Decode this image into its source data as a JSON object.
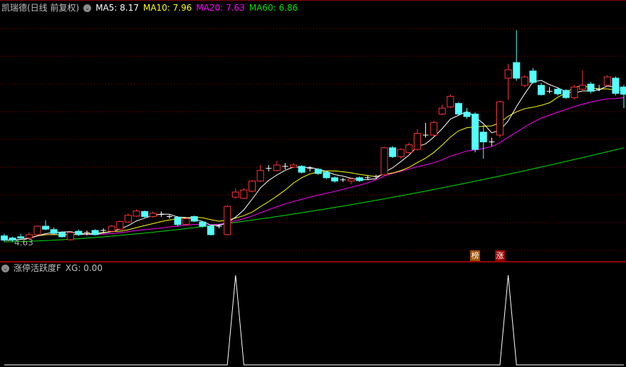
{
  "header": {
    "title": "凯瑞德(日线 前复权)",
    "ma": [
      {
        "label": "MA5: 8.17",
        "color": "#ffffff"
      },
      {
        "label": "MA10: 7.96",
        "color": "#ffff00"
      },
      {
        "label": "MA20: 7.63",
        "color": "#ff00ff"
      },
      {
        "label": "MA60: 6.86",
        "color": "#00e000"
      }
    ]
  },
  "indicator": {
    "title": "涨停活跃度F",
    "value_label": "XG: 0.00"
  },
  "markers": [
    {
      "index": 57,
      "text": "榜",
      "color": "#a05000"
    },
    {
      "index": 60,
      "text": "涨",
      "color": "#a00000"
    }
  ],
  "low_label": "4.63",
  "colors": {
    "up": "#ff3333",
    "down": "#54ffff",
    "grid": "#8b0000",
    "divider": "#c00000"
  },
  "chart_data": {
    "type": "candlestick",
    "ylim": [
      4.5,
      9.8
    ],
    "ohlc": [
      [
        4.77,
        4.67,
        4.82,
        4.63
      ],
      [
        4.72,
        4.67,
        4.75,
        4.63
      ],
      [
        4.75,
        4.72,
        4.82,
        4.68
      ],
      [
        4.72,
        4.8,
        4.85,
        4.7
      ],
      [
        4.8,
        5.0,
        5.02,
        4.78
      ],
      [
        5.0,
        4.93,
        5.14,
        4.9
      ],
      [
        4.92,
        4.83,
        4.97,
        4.8
      ],
      [
        4.85,
        4.75,
        4.88,
        4.73
      ],
      [
        4.68,
        4.85,
        4.87,
        4.66
      ],
      [
        4.88,
        4.8,
        4.92,
        4.77
      ],
      [
        4.85,
        4.85,
        4.9,
        4.78
      ],
      [
        4.9,
        4.8,
        4.93,
        4.78
      ],
      [
        4.9,
        4.9,
        4.95,
        4.85
      ],
      [
        4.88,
        5.0,
        5.03,
        4.86
      ],
      [
        4.93,
        5.11,
        5.13,
        4.9
      ],
      [
        5.1,
        5.26,
        5.3,
        5.08
      ],
      [
        5.24,
        5.36,
        5.4,
        5.22
      ],
      [
        5.35,
        5.23,
        5.37,
        5.2
      ],
      [
        5.23,
        5.31,
        5.35,
        5.2
      ],
      [
        5.28,
        5.28,
        5.35,
        5.22
      ],
      [
        5.23,
        5.23,
        5.27,
        5.18
      ],
      [
        5.21,
        5.04,
        5.24,
        5.0
      ],
      [
        5.04,
        5.18,
        5.2,
        5.02
      ],
      [
        5.23,
        5.12,
        5.25,
        5.1
      ],
      [
        5.1,
        5.0,
        5.12,
        4.97
      ],
      [
        5.0,
        4.8,
        5.02,
        4.78
      ],
      [
        5.0,
        5.0,
        5.05,
        4.95
      ],
      [
        4.8,
        5.47,
        5.5,
        4.78
      ],
      [
        5.69,
        5.81,
        5.9,
        5.65
      ],
      [
        5.66,
        5.86,
        5.9,
        5.64
      ],
      [
        5.83,
        6.07,
        6.1,
        5.8
      ],
      [
        6.07,
        6.32,
        6.45,
        6.05
      ],
      [
        6.37,
        6.37,
        6.45,
        6.3
      ],
      [
        6.32,
        6.45,
        6.55,
        6.3
      ],
      [
        6.42,
        6.42,
        6.5,
        6.35
      ],
      [
        6.4,
        6.45,
        6.5,
        6.38
      ],
      [
        6.42,
        6.28,
        6.45,
        6.25
      ],
      [
        6.37,
        6.37,
        6.42,
        6.3
      ],
      [
        6.35,
        6.25,
        6.38,
        6.22
      ],
      [
        6.28,
        6.15,
        6.3,
        6.12
      ],
      [
        6.15,
        6.07,
        6.18,
        6.03
      ],
      [
        6.1,
        6.1,
        6.15,
        6.05
      ],
      [
        6.07,
        6.12,
        6.15,
        6.0
      ],
      [
        6.15,
        6.08,
        6.18,
        6.05
      ],
      [
        6.15,
        6.15,
        6.2,
        6.1
      ],
      [
        6.18,
        6.18,
        6.22,
        6.12
      ],
      [
        6.22,
        6.86,
        6.88,
        6.2
      ],
      [
        6.86,
        6.65,
        6.9,
        6.62
      ],
      [
        6.65,
        6.82,
        6.85,
        6.6
      ],
      [
        6.75,
        6.93,
        6.98,
        6.72
      ],
      [
        6.82,
        7.2,
        7.3,
        6.8
      ],
      [
        7.16,
        7.16,
        7.45,
        7.1
      ],
      [
        7.16,
        7.46,
        7.5,
        7.12
      ],
      [
        7.66,
        7.8,
        7.88,
        7.63
      ],
      [
        7.83,
        8.08,
        8.12,
        7.8
      ],
      [
        7.91,
        7.66,
        7.95,
        7.62
      ],
      [
        7.7,
        7.6,
        7.8,
        7.55
      ],
      [
        7.66,
        6.82,
        7.7,
        6.75
      ],
      [
        7.23,
        7.0,
        7.4,
        6.6
      ],
      [
        7.0,
        7.0,
        7.1,
        6.9
      ],
      [
        7.16,
        7.95,
        7.98,
        7.1
      ],
      [
        8.51,
        8.71,
        8.85,
        8.0
      ],
      [
        8.88,
        8.51,
        9.65,
        8.45
      ],
      [
        8.34,
        8.54,
        8.58,
        8.3
      ],
      [
        8.68,
        8.41,
        8.75,
        8.38
      ],
      [
        8.34,
        8.12,
        8.4,
        8.1
      ],
      [
        8.2,
        8.2,
        8.3,
        8.15
      ],
      [
        8.25,
        8.14,
        8.3,
        8.1
      ],
      [
        8.22,
        8.05,
        8.25,
        8.02
      ],
      [
        8.05,
        8.3,
        8.35,
        8.0
      ],
      [
        8.25,
        8.34,
        8.7,
        8.2
      ],
      [
        8.37,
        8.2,
        8.42,
        8.15
      ],
      [
        8.25,
        8.25,
        8.35,
        8.2
      ],
      [
        8.34,
        8.54,
        8.58,
        8.3
      ],
      [
        8.51,
        8.15,
        8.55,
        8.1
      ],
      [
        8.3,
        8.13,
        8.35,
        7.8
      ]
    ],
    "ma60_start": 4.63,
    "ma60_end": 6.86,
    "xg": [
      0,
      0,
      0,
      0,
      0,
      0,
      0,
      0,
      0,
      0,
      0,
      0,
      0,
      0,
      0,
      0,
      0,
      0,
      0,
      0,
      0,
      0,
      0,
      0,
      0,
      0,
      0,
      0,
      1,
      0,
      0,
      0,
      0,
      0,
      0,
      0,
      0,
      0,
      0,
      0,
      0,
      0,
      0,
      0,
      0,
      0,
      0,
      0,
      0,
      0,
      0,
      0,
      0,
      0,
      0,
      0,
      0,
      0,
      0,
      0,
      0,
      1,
      0,
      0,
      0,
      0,
      0,
      0,
      0,
      0,
      0,
      0,
      0,
      0,
      0,
      0
    ]
  }
}
